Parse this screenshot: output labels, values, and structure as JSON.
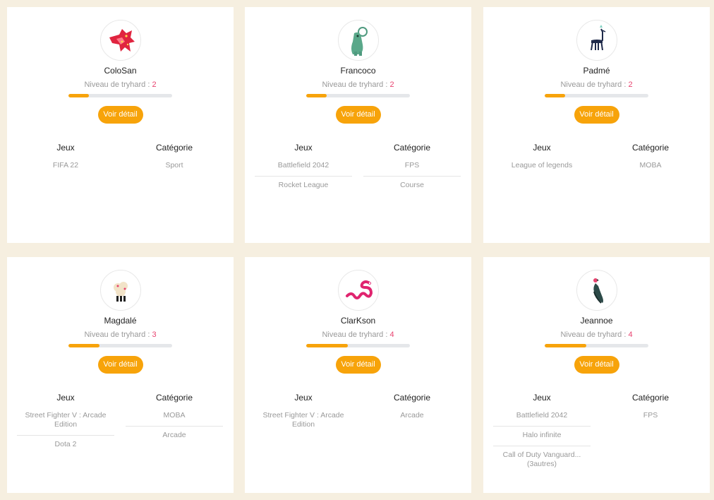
{
  "labels": {
    "level_prefix": "Niveau de tryhard :",
    "button": "Voir détail",
    "col_games": "Jeux",
    "col_category": "Catégorie"
  },
  "colors": {
    "accent": "#f7a30a",
    "level_number": "#e8436f",
    "background": "#f6efe0"
  },
  "players": [
    {
      "name": "ColoSan",
      "level": "2",
      "level_fraction": 0.2,
      "avatar_icon": "red-bird-icon",
      "games": [
        "FIFA 22"
      ],
      "categories": [
        "Sport"
      ]
    },
    {
      "name": "Francoco",
      "level": "2",
      "level_fraction": 0.2,
      "avatar_icon": "green-creature-icon",
      "games": [
        "Battlefield 2042",
        "Rocket League"
      ],
      "categories": [
        "FPS",
        "Course"
      ]
    },
    {
      "name": "Padmé",
      "level": "2",
      "level_fraction": 0.2,
      "avatar_icon": "llama-icon",
      "games": [
        "League of legends"
      ],
      "categories": [
        "MOBA"
      ]
    },
    {
      "name": "Magdalé",
      "level": "3",
      "level_fraction": 0.3,
      "avatar_icon": "fluffy-creature-icon",
      "games": [
        "Street Fighter V : Arcade Edition",
        "Dota 2"
      ],
      "categories": [
        "MOBA",
        "Arcade"
      ]
    },
    {
      "name": "ClarKson",
      "level": "4",
      "level_fraction": 0.4,
      "avatar_icon": "pink-snake-icon",
      "games": [
        "Street Fighter V : Arcade Edition"
      ],
      "categories": [
        "Arcade"
      ]
    },
    {
      "name": "Jeannoe",
      "level": "4",
      "level_fraction": 0.4,
      "avatar_icon": "parrot-icon",
      "games": [
        "Battlefield 2042",
        "Halo infinite",
        "Call of Duty Vanguard... (3autres)"
      ],
      "categories": [
        "FPS"
      ]
    }
  ]
}
